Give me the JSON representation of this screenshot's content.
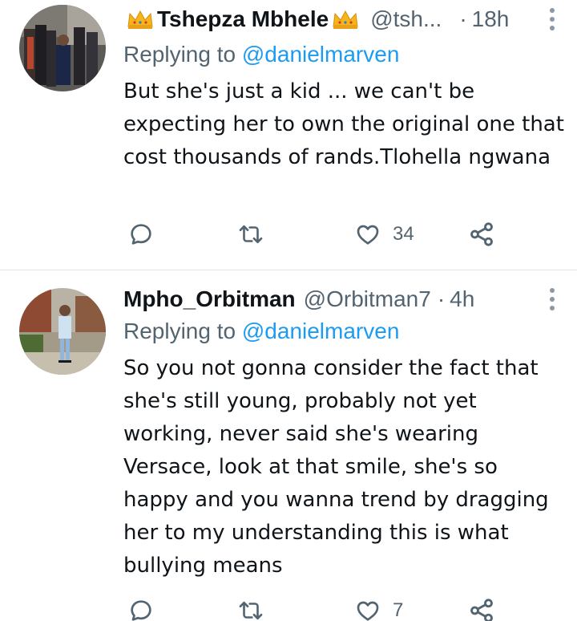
{
  "colors": {
    "text_primary": "#0f1419",
    "text_secondary": "#536471",
    "link": "#1d9bf0",
    "divider": "#e1e6ea"
  },
  "tweets": [
    {
      "display_name": "Tshepza Mbhele",
      "handle": "@tsh...",
      "dot": "·",
      "time": "18h",
      "replying_prefix": "Replying to",
      "replying_to": "@danielmarven",
      "text": "But she's just a kid ... we can't be expecting her to own the original one that cost thousands of rands.Tlohella ngwana",
      "reply_count": "",
      "retweet_count": "",
      "like_count": "34",
      "name_decorations": [
        "crown-emoji",
        "crown-emoji"
      ]
    },
    {
      "display_name": "Mpho_Orbitman",
      "handle": "@Orbitman7",
      "dot": "·",
      "time": "4h",
      "replying_prefix": "Replying to",
      "replying_to": "@danielmarven",
      "text": "So you not gonna consider the fact that she's still young, probably not yet working, never said she's wearing Versace, look at that smile, she's so happy and you wanna trend by dragging her to my understanding this is what bullying means",
      "reply_count": "",
      "retweet_count": "",
      "like_count": "7"
    }
  ],
  "icons": {
    "reply": "reply-icon",
    "retweet": "retweet-icon",
    "like": "like-icon",
    "share": "share-icon",
    "more": "more-icon"
  }
}
